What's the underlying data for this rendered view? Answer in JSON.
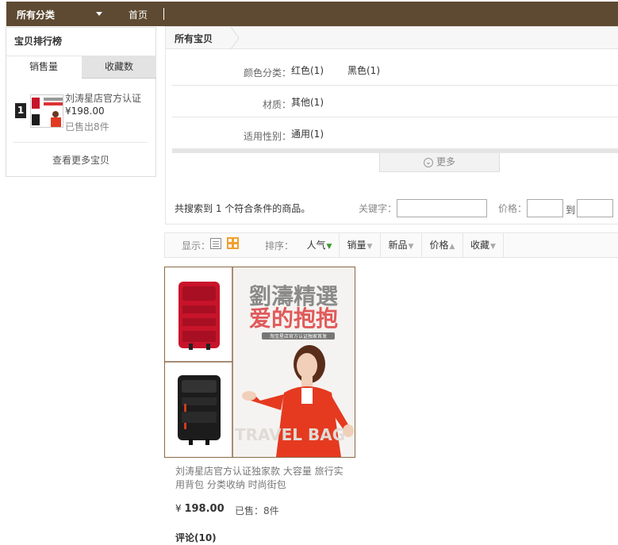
{
  "topbar": {
    "category_label": "所有分类",
    "home_label": "首页"
  },
  "sidebar": {
    "title": "宝贝排行榜",
    "tabs": [
      {
        "label": "销售量"
      },
      {
        "label": "收藏数"
      }
    ],
    "item": {
      "rank": "1",
      "name": "刘涛星店官方认证",
      "price": "¥198.00",
      "sold": "已售出8件"
    },
    "more_label": "查看更多宝贝"
  },
  "panel": {
    "breadcrumb": "所有宝贝",
    "filters": [
      {
        "label": "颜色分类：",
        "options": [
          "红色(1)",
          "黑色(1)"
        ]
      },
      {
        "label": "材质：",
        "options": [
          "其他(1)"
        ]
      },
      {
        "label": "适用性别：",
        "options": [
          "通用(1)"
        ]
      }
    ],
    "more_label": "更多",
    "summary": "共搜索到 1 个符合条件的商品。",
    "keyword_label": "关键字：",
    "keyword_value": "",
    "price_label": "价格：",
    "price_to_label": "到",
    "price_from_value": "",
    "price_to_value": ""
  },
  "sortbar": {
    "display_label": "显示：",
    "sort_label": "排序：",
    "items": [
      {
        "label": "人气",
        "arrow": "▼"
      },
      {
        "label": "销量",
        "arrow": "▼"
      },
      {
        "label": "新品",
        "arrow": "▼"
      },
      {
        "label": "价格",
        "arrow": "▲"
      },
      {
        "label": "收藏",
        "arrow": "▼"
      }
    ]
  },
  "product": {
    "image_banner_line1": "劉濤精選",
    "image_banner_line2": "爱的抱抱",
    "image_banner_small": "淘宝星店官方认证独家首发",
    "image_watermark": "TRAVEL BAG",
    "title": "刘涛星店官方认证独家款 大容量 旅行实用背包 分类收纳 时尚街包",
    "price_symbol": "¥",
    "price": "198.00",
    "sold": "已售：8件",
    "reviews": "评论(10)"
  },
  "colors": {
    "topbar_bg": "#5e4a32",
    "red_bag": "#c8142a",
    "black_bag": "#1c1c1c",
    "sort_active_arrow": "#3a9a2a",
    "grid_icon": "#f0a030"
  }
}
